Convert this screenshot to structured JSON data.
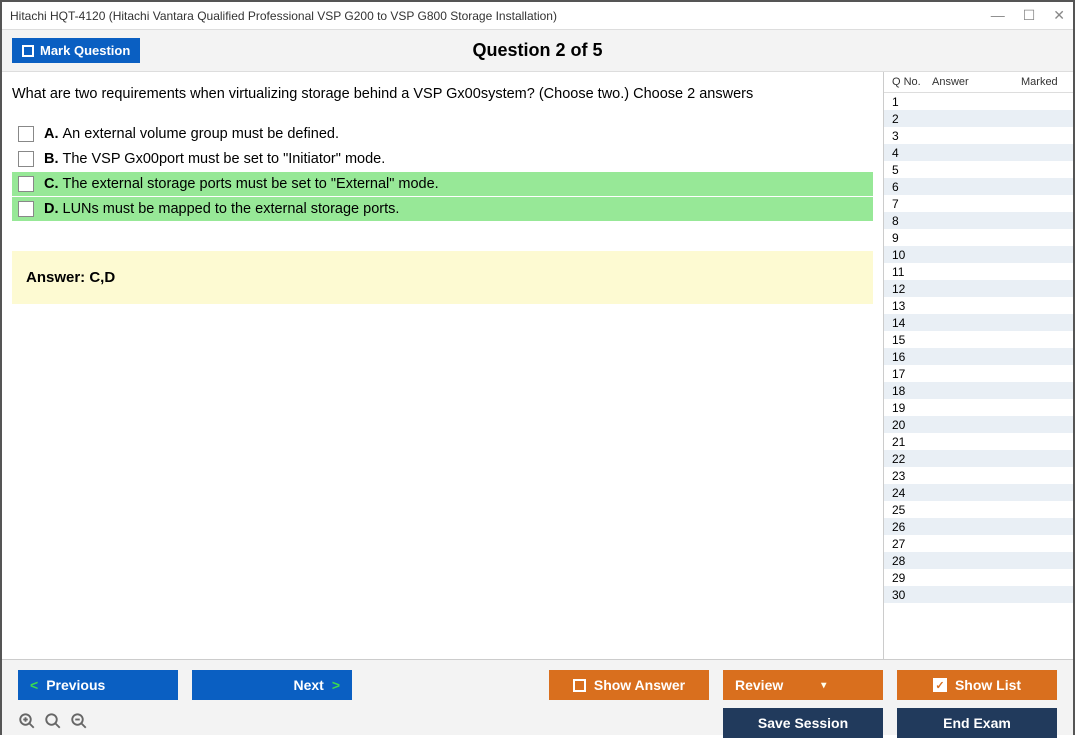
{
  "window": {
    "title": "Hitachi HQT-4120 (Hitachi Vantara Qualified Professional VSP G200 to VSP G800 Storage Installation)"
  },
  "header": {
    "mark_label": "Mark Question",
    "question_label": "Question 2 of 5"
  },
  "question": {
    "text": "What are two requirements when virtualizing storage behind a VSP Gx00system? (Choose two.) Choose 2 answers",
    "choices": [
      {
        "letter": "A.",
        "text": "An external volume group must be defined.",
        "correct": false
      },
      {
        "letter": "B.",
        "text": "The VSP Gx00port must be set to \"Initiator\" mode.",
        "correct": false
      },
      {
        "letter": "C.",
        "text": "The external storage ports must be set to \"External\" mode.",
        "correct": true
      },
      {
        "letter": "D.",
        "text": "LUNs must be mapped to the external storage ports.",
        "correct": true
      }
    ],
    "answer_label": "Answer: C,D"
  },
  "side": {
    "col_qno": "Q No.",
    "col_answer": "Answer",
    "col_marked": "Marked",
    "row_count": 30
  },
  "buttons": {
    "previous": "Previous",
    "next": "Next",
    "show_answer": "Show Answer",
    "review": "Review",
    "show_list": "Show List",
    "save_session": "Save Session",
    "end_exam": "End Exam"
  }
}
